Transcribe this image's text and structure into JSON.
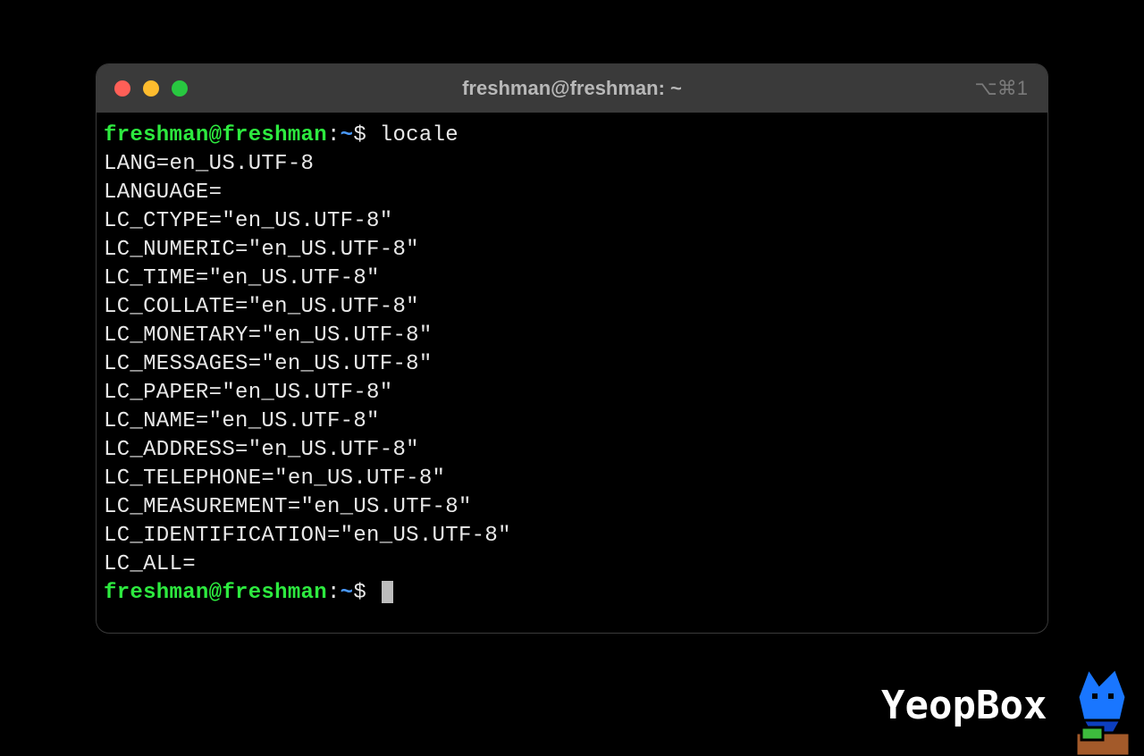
{
  "window": {
    "title": "freshman@freshman: ~",
    "shortcut": "⌥⌘1"
  },
  "prompt": {
    "user_host": "freshman@freshman",
    "separator": ":",
    "path": "~",
    "dollar": "$"
  },
  "command": "locale",
  "output": [
    "LANG=en_US.UTF-8",
    "LANGUAGE=",
    "LC_CTYPE=\"en_US.UTF-8\"",
    "LC_NUMERIC=\"en_US.UTF-8\"",
    "LC_TIME=\"en_US.UTF-8\"",
    "LC_COLLATE=\"en_US.UTF-8\"",
    "LC_MONETARY=\"en_US.UTF-8\"",
    "LC_MESSAGES=\"en_US.UTF-8\"",
    "LC_PAPER=\"en_US.UTF-8\"",
    "LC_NAME=\"en_US.UTF-8\"",
    "LC_ADDRESS=\"en_US.UTF-8\"",
    "LC_TELEPHONE=\"en_US.UTF-8\"",
    "LC_MEASUREMENT=\"en_US.UTF-8\"",
    "LC_IDENTIFICATION=\"en_US.UTF-8\"",
    "LC_ALL="
  ],
  "watermark": {
    "text": "YeopBox"
  }
}
